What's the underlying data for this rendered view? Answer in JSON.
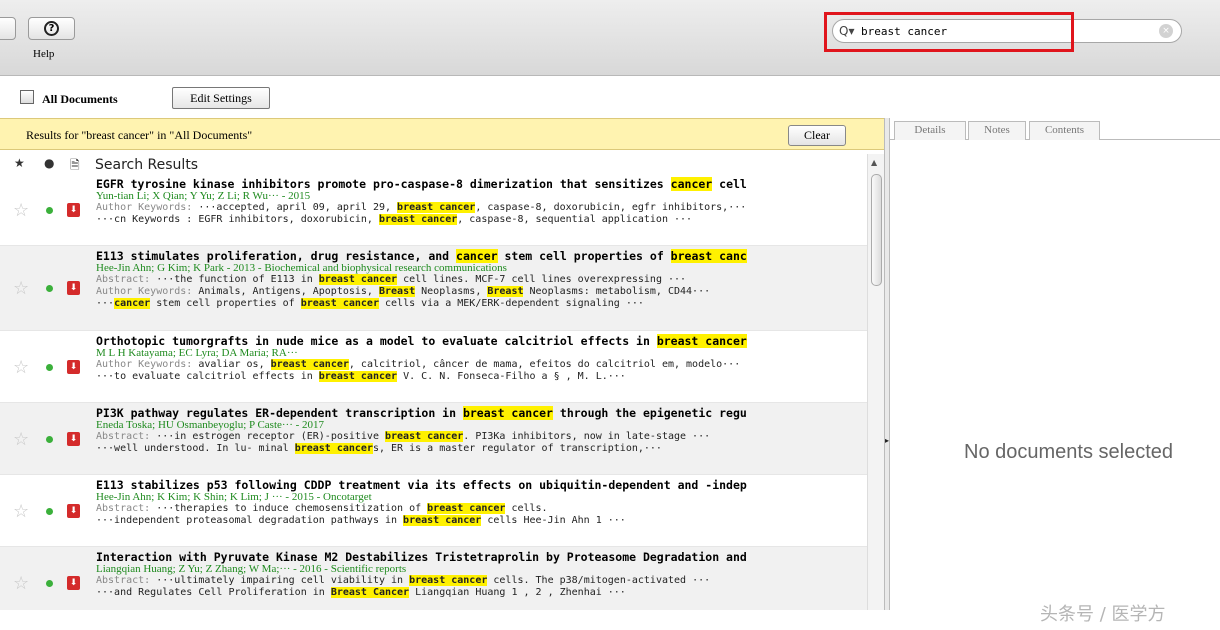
{
  "toolbar": {
    "help_label": "Help",
    "help_glyph": "?",
    "search": {
      "icon": "search-icon",
      "glyph": "Q▾",
      "value": "breast cancer",
      "clear_glyph": "×"
    }
  },
  "collection": {
    "title": "All Documents",
    "edit_settings": "Edit Settings"
  },
  "results_bar": {
    "text": "Results for \"breast cancer\" in \"All Documents\"",
    "clear": "Clear"
  },
  "list_header": {
    "star_glyph": "★",
    "dot_glyph": "●",
    "doc_glyph": "🗎",
    "title": "Search Results"
  },
  "results": [
    {
      "title": [
        {
          "t": "EGFR tyrosine kinase inhibitors promote pro-caspase-8 dimerization that sensitizes "
        },
        {
          "t": "cancer",
          "h": true
        },
        {
          "t": " cell"
        }
      ],
      "authors": "Yun-tian Li; X Qian; Y Yu; Z Li; R Wu··· - 2015",
      "lines": [
        [
          {
            "t": "Author Keywords: ",
            "l": true
          },
          {
            "t": "···accepted, april 09, april 29, "
          },
          {
            "t": "breast cancer",
            "h": true
          },
          {
            "t": ", caspase-8, doxorubicin, egfr inhibitors,···"
          }
        ],
        [
          {
            "t": "···cn Keywords : EGFR inhibitors, doxorubicin, "
          },
          {
            "t": "breast cancer",
            "h": true
          },
          {
            "t": ", caspase-8, sequential application ···"
          }
        ]
      ]
    },
    {
      "title": [
        {
          "t": "E113 stimulates proliferation, drug resistance, and "
        },
        {
          "t": "cancer",
          "h": true
        },
        {
          "t": " stem cell properties of "
        },
        {
          "t": "breast canc",
          "h": true
        }
      ],
      "authors": "Hee-Jin Ahn; G Kim; K Park - 2013 - Biochemical and biophysical research communications",
      "lines": [
        [
          {
            "t": "Abstract: ",
            "l": true
          },
          {
            "t": "···the function of E113 in "
          },
          {
            "t": "breast cancer",
            "h": true
          },
          {
            "t": " cell lines. MCF-7 cell lines overexpressing ···"
          }
        ],
        [
          {
            "t": "Author Keywords: ",
            "l": true
          },
          {
            "t": "Animals, Antigens, Apoptosis, "
          },
          {
            "t": "Breast",
            "h": true
          },
          {
            "t": " Neoplasms, "
          },
          {
            "t": "Breast",
            "h": true
          },
          {
            "t": " Neoplasms: metabolism, CD44···"
          }
        ],
        [
          {
            "t": "···"
          },
          {
            "t": "cancer",
            "h": true
          },
          {
            "t": " stem cell properties of "
          },
          {
            "t": "breast cancer",
            "h": true
          },
          {
            "t": " cells via a MEK/ERK-dependent signaling ···"
          }
        ]
      ]
    },
    {
      "title": [
        {
          "t": "Orthotopic tumorgrafts in nude mice as a model to evaluate calcitriol effects in "
        },
        {
          "t": "breast cancer",
          "h": true
        }
      ],
      "authors": "M L H Katayama; EC Lyra; DA Maria; RA···",
      "lines": [
        [
          {
            "t": "Author Keywords: ",
            "l": true
          },
          {
            "t": "avaliar os, "
          },
          {
            "t": "breast cancer",
            "h": true
          },
          {
            "t": ", calcitriol, câncer de mama, efeitos do calcitriol em, modelo···"
          }
        ],
        [
          {
            "t": "···to evaluate calcitriol effects in "
          },
          {
            "t": "breast cancer",
            "h": true
          },
          {
            "t": " V. C. N. Fonseca-Filho a § , M. L.···"
          }
        ]
      ]
    },
    {
      "title": [
        {
          "t": "PI3K pathway regulates ER-dependent transcription in "
        },
        {
          "t": "breast cancer",
          "h": true
        },
        {
          "t": " through the epigenetic regu"
        }
      ],
      "authors": "Eneda Toska; HU Osmanbeyoglu; P Caste··· - 2017",
      "lines": [
        [
          {
            "t": "Abstract: ",
            "l": true
          },
          {
            "t": "···in estrogen receptor (ER)-positive "
          },
          {
            "t": "breast cancer",
            "h": true
          },
          {
            "t": ". PI3Ka inhibitors, now in late-stage ···"
          }
        ],
        [
          {
            "t": "···well understood. In lu- minal "
          },
          {
            "t": "breast cancer",
            "h": true
          },
          {
            "t": "s, ER is a master regulator of transcription,···"
          }
        ]
      ]
    },
    {
      "title": [
        {
          "t": "E113 stabilizes p53 following CDDP treatment via its effects on ubiquitin-dependent and -indep"
        }
      ],
      "authors": "Hee-Jin Ahn; K Kim; K Shin; K Lim; J ··· - 2015 - Oncotarget",
      "lines": [
        [
          {
            "t": "Abstract: ",
            "l": true
          },
          {
            "t": "···therapies to induce chemosensitization of "
          },
          {
            "t": "breast cancer",
            "h": true
          },
          {
            "t": " cells."
          }
        ],
        [
          {
            "t": "···independent proteasomal degradation pathways in "
          },
          {
            "t": "breast cancer",
            "h": true
          },
          {
            "t": " cells Hee-Jin Ahn 1 ···"
          }
        ]
      ]
    },
    {
      "title": [
        {
          "t": "Interaction with Pyruvate Kinase M2 Destabilizes Tristetraprolin by Proteasome Degradation and"
        }
      ],
      "authors": "Liangqian Huang; Z Yu; Z Zhang; W Ma;··· - 2016 - Scientific reports",
      "lines": [
        [
          {
            "t": "Abstract: ",
            "l": true
          },
          {
            "t": "···ultimately impairing cell viability in "
          },
          {
            "t": "breast cancer",
            "h": true
          },
          {
            "t": " cells. The p38/mitogen-activated ···"
          }
        ],
        [
          {
            "t": "···and Regulates Cell Proliferation in "
          },
          {
            "t": "Breast Cancer",
            "h": true
          },
          {
            "t": " Liangqian  Huang 1 , 2 , Zhenhai  ···"
          }
        ]
      ]
    }
  ],
  "details": {
    "tabs": [
      "Details",
      "Notes",
      "Contents"
    ],
    "empty_message": "No documents selected"
  },
  "watermark": "头条号 / 医学方"
}
